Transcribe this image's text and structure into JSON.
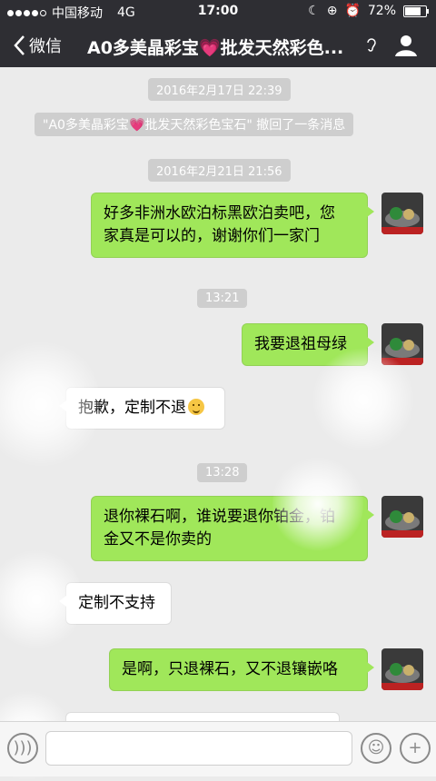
{
  "status_bar": {
    "carrier": "中国移动",
    "network": "4G",
    "time": "17:00",
    "battery": "72%"
  },
  "nav": {
    "back_label": "微信",
    "title_part1": "A0多美晶彩宝",
    "title_part2": "批发天然彩色..."
  },
  "messages": [
    {
      "type": "time",
      "text": "2016年2月17日 22:39"
    },
    {
      "type": "recall",
      "text_part1": "\"A0多美晶彩宝",
      "text_part2": "批发天然彩色宝石\" 撤回了一条消息"
    },
    {
      "type": "time",
      "text": "2016年2月21日 21:56"
    },
    {
      "type": "me",
      "line1": "好多非洲水欧泊标黑欧泊卖吧，您",
      "line2": "家真是可以的，谢谢你们一家门"
    },
    {
      "type": "time",
      "text": "13:21"
    },
    {
      "type": "me",
      "line1": "我要退祖母绿"
    },
    {
      "type": "them",
      "line1": "抱歉，定制不退"
    },
    {
      "type": "time",
      "text": "13:28"
    },
    {
      "type": "me",
      "line1": "退你裸石啊，谁说要退你铂金，铂",
      "line2": "金又不是你卖的"
    },
    {
      "type": "them",
      "line1": "定制不支持"
    },
    {
      "type": "me",
      "line1": "是啊，只退裸石，又不退镶嵌咯"
    }
  ],
  "icons": {
    "heart": "💗",
    "emoji": "smiling-face",
    "voice": "voice-icon",
    "sticker": "smiley-icon",
    "plus": "+"
  }
}
